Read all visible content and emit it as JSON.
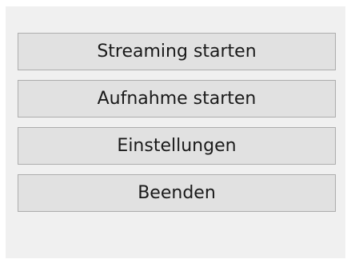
{
  "controls": {
    "buttons": [
      {
        "label": "Streaming starten"
      },
      {
        "label": "Aufnahme starten"
      },
      {
        "label": "Einstellungen"
      },
      {
        "label": "Beenden"
      }
    ]
  },
  "colors": {
    "panel_background": "#f0f0f0",
    "button_background": "#e1e1e1",
    "button_border": "#adadad",
    "text": "#1a1a1a"
  }
}
